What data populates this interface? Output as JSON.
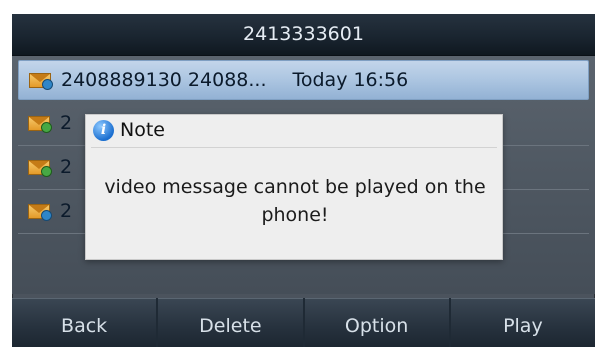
{
  "header": {
    "title": "2413333601"
  },
  "messages": [
    {
      "number": "2408889130 24088...",
      "time": "Today 16:56",
      "selected": true
    },
    {
      "number": "2",
      "time": "",
      "selected": false
    },
    {
      "number": "2",
      "time": "",
      "selected": false
    },
    {
      "number": "2",
      "time": "",
      "selected": false
    }
  ],
  "dialog": {
    "title": "Note",
    "message": "video message cannot be played on the phone!"
  },
  "softkeys": [
    "Back",
    "Delete",
    "Option",
    "Play"
  ],
  "icons": {
    "message": "video-message-envelope-icon",
    "info": "info-icon"
  }
}
